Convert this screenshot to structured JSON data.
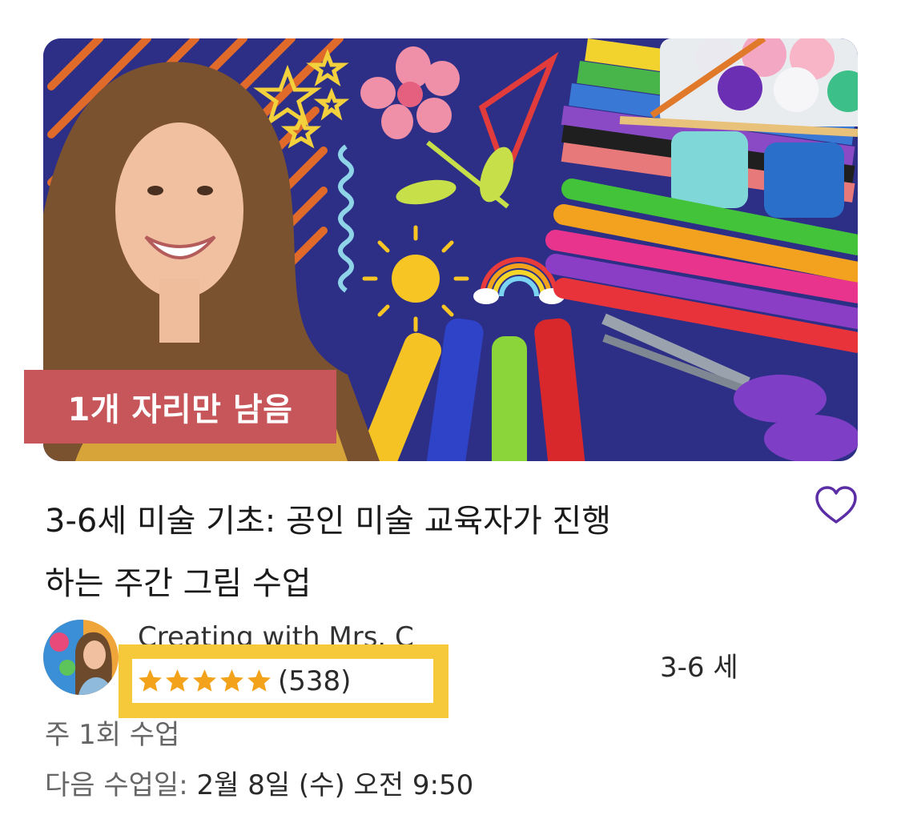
{
  "card": {
    "thumbnail_alt": "art class thumbnail",
    "badge": "1개 자리만 남음",
    "title_line1": "3-6세 미술 기초: 공인 미술 교육자가 진행",
    "title_line2": "하는 주간 그림 수업",
    "favorite_icon": "heart-outline-icon",
    "teacher": {
      "name": "Creating with Mrs. C",
      "rating_stars": 5,
      "review_count": "(538)"
    },
    "age_range": "3-6 세",
    "frequency": "주 1회 수업",
    "next_class_label": "다음 수업일:",
    "next_class_value": "2월 8일 (수) 오전 9:50"
  },
  "colors": {
    "badge_bg": "#c6565a",
    "highlight": "#f6c93a",
    "star": "#f2a31b",
    "heart": "#5b2ea6",
    "thumbnail_bg": "#2d2f86"
  }
}
